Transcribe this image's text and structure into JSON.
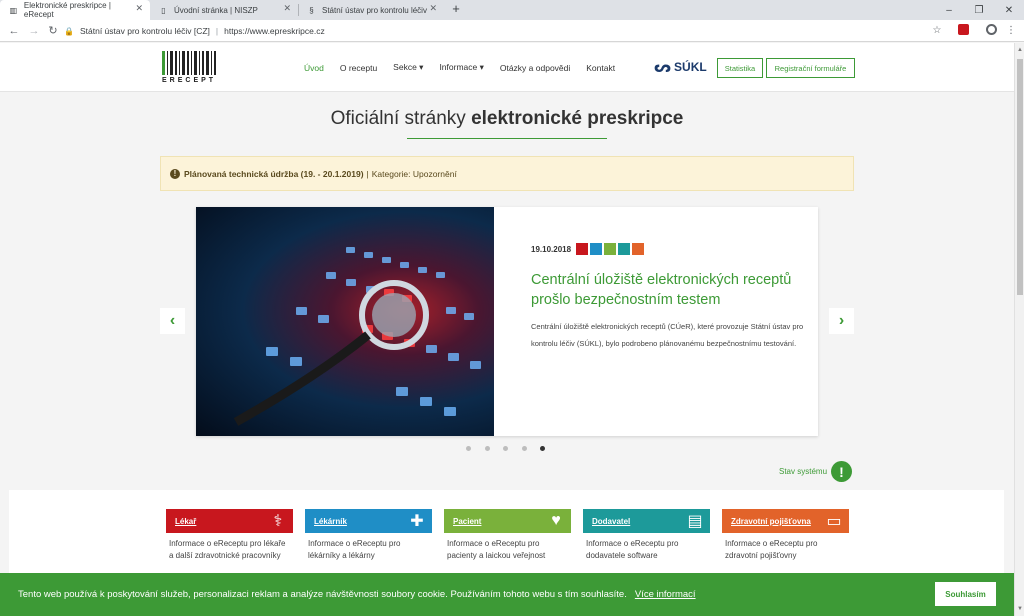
{
  "browser": {
    "tabs": [
      {
        "title": "Elektronické preskripce | eRecept",
        "icon": "barcode-icon"
      },
      {
        "title": "Úvodní stránka | NISZP",
        "icon": "page-icon"
      },
      {
        "title": "Státní ústav pro kontrolu léčiv",
        "icon": "sukl-icon"
      }
    ],
    "new_tab": "+",
    "window_controls": [
      "–",
      "❐",
      "✕"
    ],
    "site_name": "Státní ústav pro kontrolu léčiv [CZ]",
    "url": "https://www.epreskripce.cz",
    "nav_glyphs": {
      "back": "←",
      "forward": "→",
      "reload": "↻",
      "star": "☆",
      "menu": "⋮"
    }
  },
  "header": {
    "logo_text": "ERECEPT",
    "nav": [
      "Úvod",
      "O receptu",
      "Sekce ▾",
      "Informace ▾",
      "Otázky a odpovědi",
      "Kontakt"
    ],
    "sukl_logo": "SÚKL",
    "buttons": {
      "stats": "Statistika",
      "register": "Registrační formuláře"
    }
  },
  "page": {
    "title_light": "Oficiální stránky ",
    "title_bold": "elektronické preskripce"
  },
  "notice": {
    "title": "Plánovaná technická údržba (19. - 20.1.2019)",
    "separator": "|",
    "category": "Kategorie: Upozornění"
  },
  "carousel": {
    "date": "19.10.2018",
    "chip_colors": [
      "#c8171e",
      "#1f8ec6",
      "#7ab13b",
      "#1d9a9a",
      "#e2632a"
    ],
    "headline": "Centrální úložiště elektronických receptů prošlo bezpečnostním testem",
    "text": "Centrální úložiště elektronických receptů (CÚeR), které provozuje Státní ústav pro kontrolu léčiv (SÚKL), bylo podrobeno plánovanému bezpečnostnímu testování.",
    "prev": "‹",
    "next": "›",
    "slide_count": 5,
    "active_slide": 5
  },
  "status": {
    "label": "Stav systému",
    "icon": "!"
  },
  "sections": [
    {
      "label": "Lékař",
      "color": "#c8171e",
      "icon": "stethoscope-icon",
      "glyph": "⚕",
      "desc": "Informace o eReceptu pro lékaře a další zdravotnické pracovníky"
    },
    {
      "label": "Lékárník",
      "color": "#1f8ec6",
      "icon": "pharmacy-cross-icon",
      "glyph": "✚",
      "desc": "Informace o eReceptu pro lékárníky a lékárny"
    },
    {
      "label": "Pacient",
      "color": "#7ab13b",
      "icon": "heart-plus-icon",
      "glyph": "♥",
      "desc": "Informace o eReceptu pro pacienty a laickou veřejnost"
    },
    {
      "label": "Dodavatel",
      "color": "#1d9a9a",
      "icon": "clipboard-icon",
      "glyph": "▤",
      "desc": "Informace o eReceptu pro dodavatele software"
    },
    {
      "label": "Zdravotní pojišťovna",
      "color": "#e2632a",
      "icon": "card-icon",
      "glyph": "▭",
      "desc": "Informace o eReceptu pro zdravotní pojišťovny"
    }
  ],
  "cookie": {
    "text": "Tento web používá k poskytování služeb, personalizaci reklam a analýze návštěvnosti soubory cookie. Používáním tohoto webu s tím souhlasíte.",
    "more": "Více informací",
    "accept": "Souhlasím"
  }
}
